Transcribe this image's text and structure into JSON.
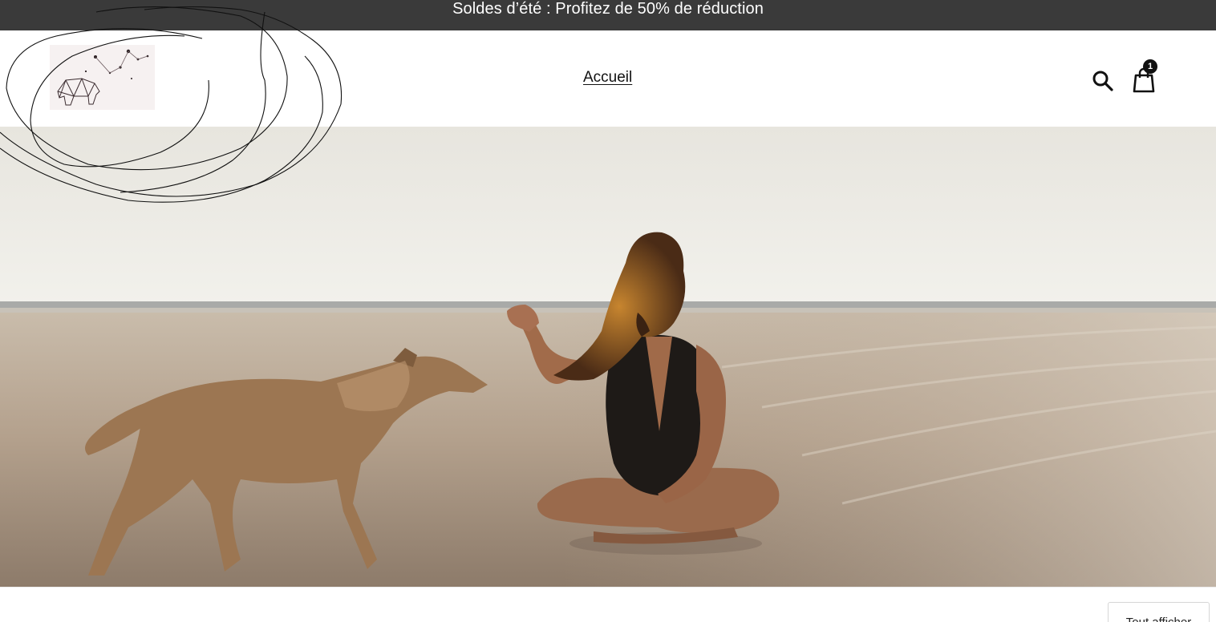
{
  "announcement": {
    "text": "Soldes d’été : Profitez de 50% de réduction"
  },
  "header": {
    "nav": [
      {
        "label": "Accueil"
      }
    ],
    "cart_count": "1",
    "icons": {
      "logo": "bear-constellation-logo",
      "search": "search-icon",
      "cart": "shopping-bag-icon"
    }
  },
  "hero": {
    "image": "beach-woman-dog-photo"
  },
  "collection": {
    "view_all_label": "Tout afficher"
  },
  "colors": {
    "announcement_bg": "#3a3a3a",
    "announcement_text": "#ffffff",
    "badge_bg": "#111111"
  }
}
